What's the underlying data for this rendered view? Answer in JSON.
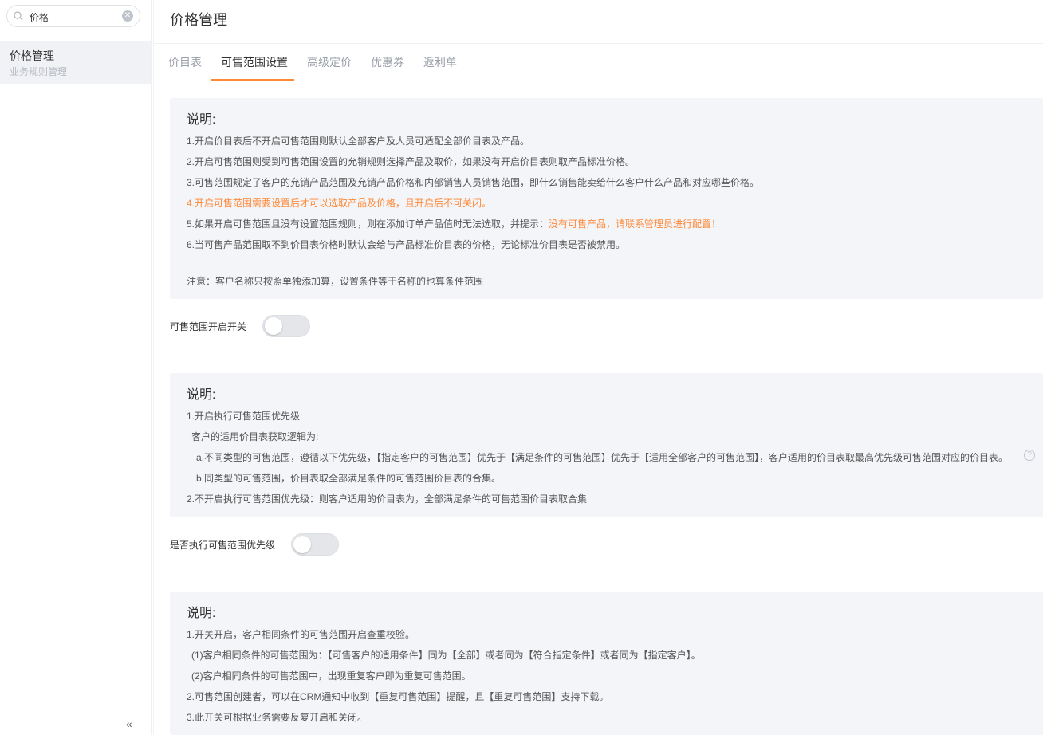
{
  "sidebar": {
    "search": {
      "value": "价格",
      "clear_icon": "close-circle-icon",
      "search_icon": "search-icon"
    },
    "item": {
      "title": "价格管理",
      "subtitle": "业务规则管理"
    },
    "collapse_icon": "«"
  },
  "main": {
    "title": "价格管理",
    "tabs": [
      {
        "label": "价目表"
      },
      {
        "label": "可售范围设置",
        "active": true
      },
      {
        "label": "高级定价"
      },
      {
        "label": "优惠券"
      },
      {
        "label": "返利单"
      }
    ],
    "box1": {
      "heading": "说明:",
      "lines": [
        "1.开启价目表后不开启可售范围则默认全部客户及人员可适配全部价目表及产品。",
        "2.开启可售范围则受到可售范围设置的允销规则选择产品及取价，如果没有开启价目表则取产品标准价格。",
        "3.可售范围规定了客户的允销产品范围及允销产品价格和内部销售人员销售范围，即什么销售能卖给什么客户什么产品和对应哪些价格。",
        "4.开启可售范围需要设置后才可以选取产品及价格，且开启后不可关闭。",
        "5.如果开启可售范围且没有设置范围规则，则在添加订单产品值时无法选取，并提示：",
        "没有可售产品，请联系管理员进行配置！",
        "6.当可售产品范围取不到价目表价格时默认会给与产品标准价目表的价格，无论标准价目表是否被禁用。",
        "注意：客户名称只按照单独添加算，设置条件等于名称的也算条件范围"
      ]
    },
    "switch1": {
      "label": "可售范围开启开关",
      "on": false
    },
    "box2": {
      "heading": "说明:",
      "lines": [
        "1.开启执行可售范围优先级:",
        "客户的适用价目表获取逻辑为:",
        "a.不同类型的可售范围，遵循以下优先级，【指定客户的可售范围】优先于【满足条件的可售范围】优先于【适用全部客户的可售范围】，客户适用的价目表取最高优先级可售范围对应的价目表。",
        "b.同类型的可售范围，价目表取全部满足条件的可售范围价目表的合集。",
        "2.不开启执行可售范围优先级：则客户适用的价目表为，全部满足条件的可售范围价目表取合集"
      ],
      "help_icon": "?"
    },
    "switch2": {
      "label": "是否执行可售范围优先级",
      "on": false
    },
    "box3": {
      "heading": "说明:",
      "lines": [
        "1.开关开启，客户相同条件的可售范围开启查重校验。",
        "(1)客户相同条件的可售范围为：【可售客户的适用条件】同为【全部】或者同为【符合指定条件】或者同为【指定客户】。",
        "(2)客户相同条件的可售范围中，出现重复客户即为重复可售范围。",
        "2.可售范围创建者，可以在CRM通知中收到【重复可售范围】提醒，且【重复可售范围】支持下载。",
        "3.此开关可根据业务需要反复开启和关闭。"
      ]
    }
  },
  "colors": {
    "accent": "#ff8837",
    "panel": "#f3f5f8"
  }
}
